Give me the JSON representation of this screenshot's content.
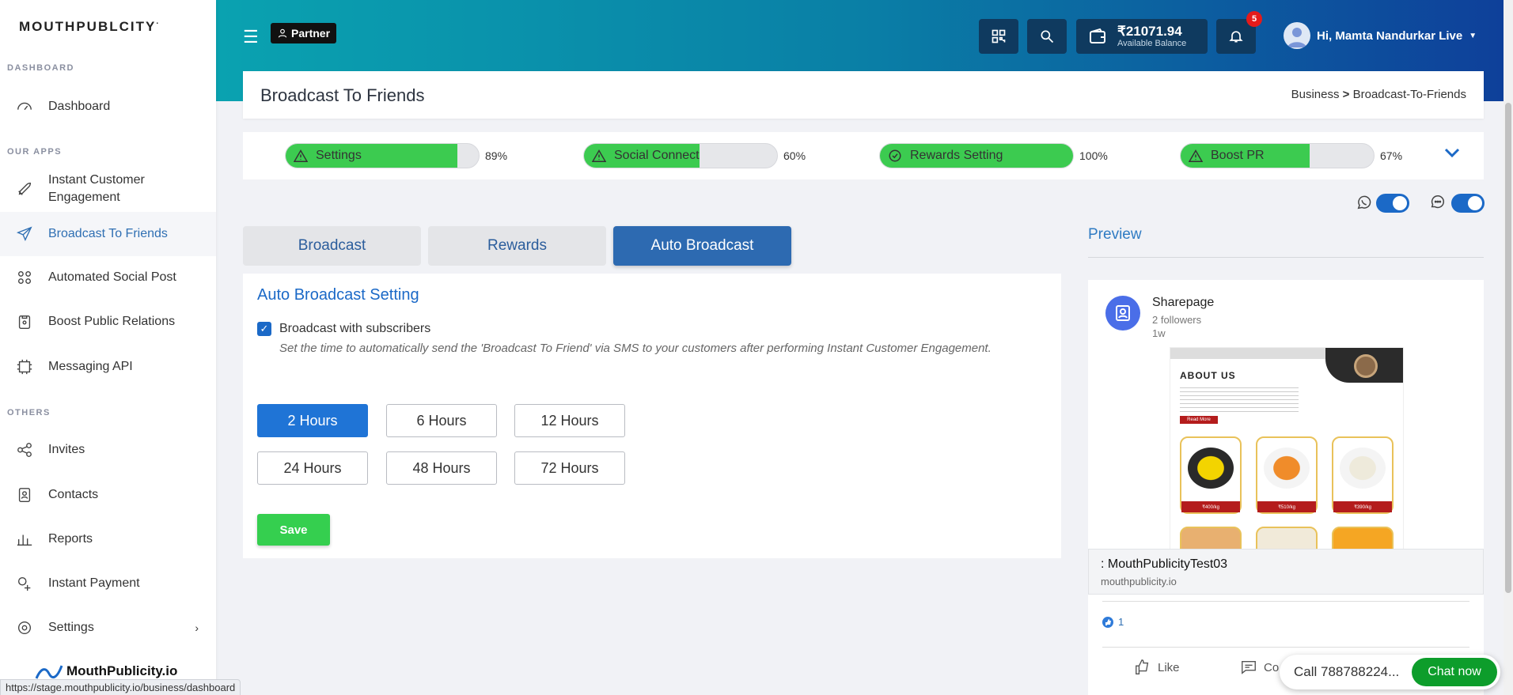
{
  "sidebar": {
    "logo": "MOUTHPUBLCITY",
    "logo_mark": "·",
    "sections": {
      "dashboard": "DASHBOARD",
      "apps": "OUR APPS",
      "others": "OTHERS"
    },
    "items": [
      {
        "label": "Dashboard",
        "icon": "gauge-icon"
      },
      {
        "label": "Instant Customer Engagement",
        "icon": "rocket-icon"
      },
      {
        "label": "Broadcast To Friends",
        "icon": "paper-plane-icon"
      },
      {
        "label": "Automated Social Post",
        "icon": "social-icon"
      },
      {
        "label": "Boost Public Relations",
        "icon": "clipboard-icon"
      },
      {
        "label": "Messaging API",
        "icon": "api-icon"
      },
      {
        "label": "Invites",
        "icon": "share-icon"
      },
      {
        "label": "Contacts",
        "icon": "contacts-icon"
      },
      {
        "label": "Reports",
        "icon": "chart-icon"
      },
      {
        "label": "Instant Payment",
        "icon": "payment-icon"
      },
      {
        "label": "Settings",
        "icon": "gear-icon"
      }
    ],
    "bottom_brand": "MouthPublicity.io"
  },
  "status_url": "https://stage.mouthpublicity.io/business/dashboard",
  "header": {
    "partner_label": "Partner",
    "balance_amount": "₹21071.94",
    "balance_label": "Available Balance",
    "notification_count": "5",
    "user_greeting": "Hi, Mamta Nandurkar Live"
  },
  "page": {
    "title": "Broadcast To Friends",
    "breadcrumb_parent": "Business",
    "breadcrumb_sep": ">",
    "breadcrumb_current": "Broadcast-To-Friends"
  },
  "progress": [
    {
      "label": "Settings",
      "percent": 89,
      "percent_text": "89%",
      "status": "warning"
    },
    {
      "label": "Social Connect",
      "percent": 60,
      "percent_text": "60%",
      "status": "warning"
    },
    {
      "label": "Rewards Setting",
      "percent": 100,
      "percent_text": "100%",
      "status": "done"
    },
    {
      "label": "Boost PR",
      "percent": 67,
      "percent_text": "67%",
      "status": "warning"
    }
  ],
  "tabs": [
    {
      "label": "Broadcast",
      "active": false
    },
    {
      "label": "Rewards",
      "active": false
    },
    {
      "label": "Auto Broadcast",
      "active": true
    }
  ],
  "form": {
    "title": "Auto Broadcast Setting",
    "checkbox_label": "Broadcast with subscribers",
    "description": "Set the time to automatically send the 'Broadcast To Friend' via SMS to your customers after performing Instant Customer Engagement.",
    "hours": [
      "2 Hours",
      "6 Hours",
      "12 Hours",
      "24 Hours",
      "48 Hours",
      "72 Hours"
    ],
    "selected_hour": "2 Hours",
    "save_label": "Save"
  },
  "preview": {
    "title": "Preview",
    "page_name": "Sharepage",
    "followers": "2 followers",
    "time": "1w",
    "image_heading": "ABOUT US",
    "image_button": "Read More",
    "prices": [
      "₹400/kg",
      "₹510/kg",
      "₹390/kg"
    ],
    "link_title": ": MouthPublicityTest03",
    "link_domain": "mouthpublicity.io",
    "reaction_count": "1",
    "like_label": "Like",
    "comment_label": "Co"
  },
  "chat": {
    "call_text": "Call 788788224...",
    "chat_label": "Chat now"
  },
  "colors": {
    "accent": "#1b69c7",
    "progress_green": "#3ccb50",
    "save_green": "#35cf4f",
    "chat_green": "#0d9d2b",
    "badge_red": "#e41b1b"
  }
}
